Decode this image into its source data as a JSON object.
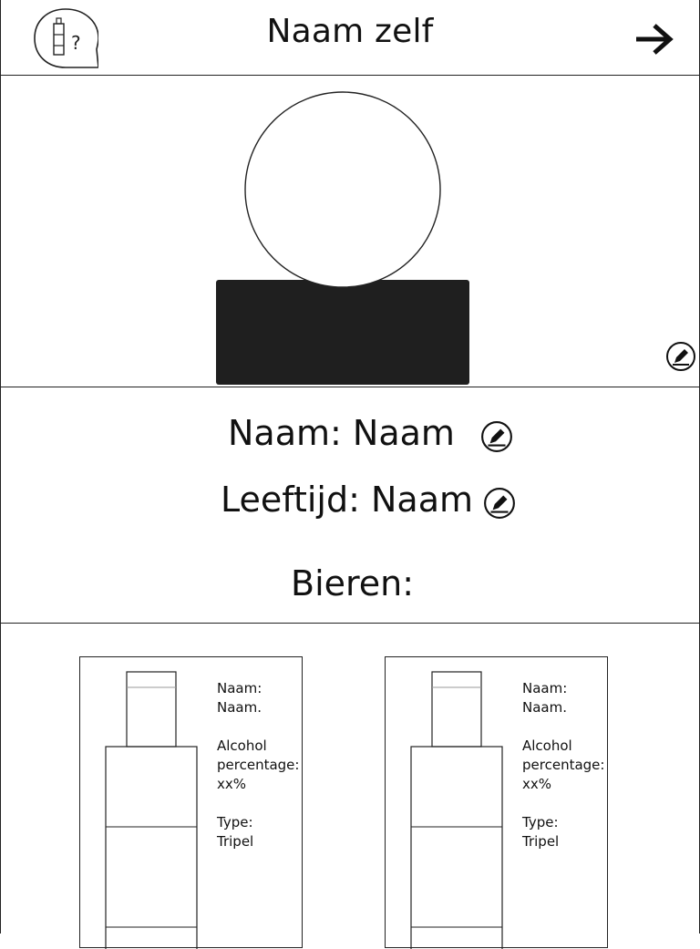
{
  "header": {
    "title": "Naam zelf",
    "help_icon": "bottle-question-icon",
    "next_icon": "arrow-right-icon"
  },
  "profile": {
    "avatar": "avatar-placeholder",
    "edit_icon": "pencil-icon"
  },
  "info": {
    "name_line": "Naam: Naam",
    "age_line": "Leeftijd: Naam",
    "beers_heading": "Bieren:"
  },
  "beers": [
    {
      "name_label": "Naam:",
      "name_value": "Naam.",
      "alcohol_label_1": "Alcohol",
      "alcohol_label_2": "percentage:",
      "alcohol_value": "xx%",
      "type_label": "Type:",
      "type_value": "Tripel"
    },
    {
      "name_label": "Naam:",
      "name_value": "Naam.",
      "alcohol_label_1": "Alcohol",
      "alcohol_label_2": "percentage:",
      "alcohol_value": "xx%",
      "type_label": "Type:",
      "type_value": "Tripel"
    }
  ],
  "colors": {
    "line": "#222222",
    "avatar_body": "#1f1f1f",
    "background": "#ffffff"
  }
}
